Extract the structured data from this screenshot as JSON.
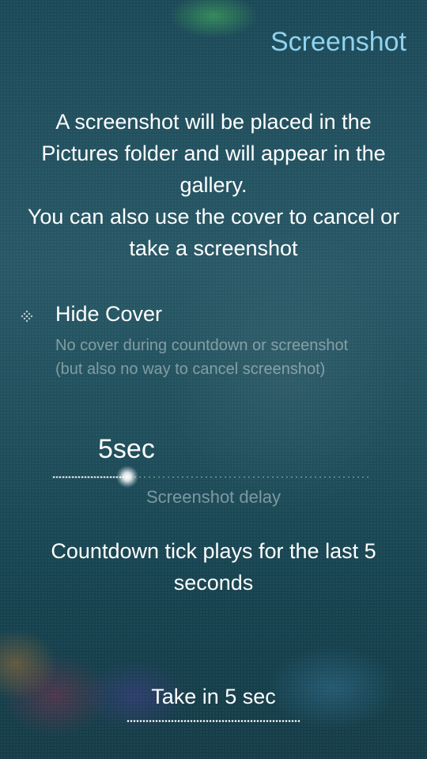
{
  "page": {
    "title": "Screenshot"
  },
  "intro": {
    "lines": [
      "A screenshot will be placed in the",
      "Pictures folder and will appear in the",
      "gallery.",
      "You can also use the cover to cancel or",
      "take a screenshot"
    ]
  },
  "hide_cover": {
    "label": "Hide Cover",
    "description_lines": [
      "No cover during countdown or screenshot",
      "(but also no way to cancel screenshot)"
    ],
    "checked": false
  },
  "delay_slider": {
    "value_text": "5sec",
    "label": "Screenshot delay",
    "value": 5
  },
  "countdown_note": {
    "lines": [
      "Countdown tick plays for the last 5",
      "seconds"
    ]
  },
  "take_button": {
    "label": "Take in 5 sec"
  },
  "colors": {
    "accent": "#8fd3ef",
    "text": "#ffffff",
    "secondary_text": "rgba(255,255,255,0.42)"
  }
}
